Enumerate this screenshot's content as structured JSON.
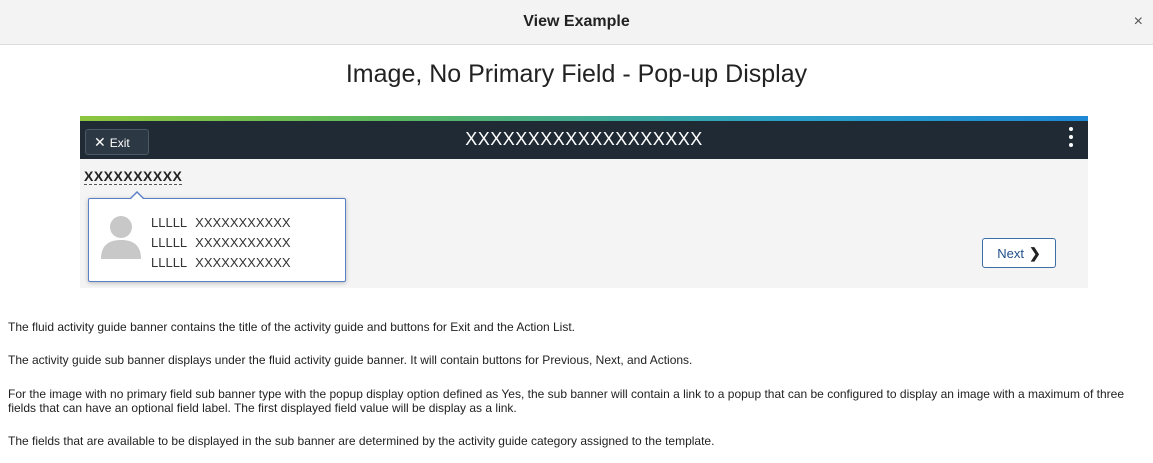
{
  "dialog": {
    "title": "View Example",
    "close": "×"
  },
  "heading": "Image, No Primary Field - Pop-up Display",
  "banner": {
    "exit_icon": "✕",
    "exit_label": "Exit",
    "title": "XXXXXXXXXXXXXXXXXXX",
    "menu_icon": "kebab-icon"
  },
  "sub_banner": {
    "link_text": "XXXXXXXXXX",
    "next_label": "Next",
    "next_chevron": "❯"
  },
  "popup": {
    "rows": [
      {
        "label": "LLLLL",
        "value": "XXXXXXXXXXX"
      },
      {
        "label": "LLLLL",
        "value": "XXXXXXXXXXX"
      },
      {
        "label": "LLLLL",
        "value": "XXXXXXXXXXX"
      }
    ]
  },
  "paragraphs": [
    "The fluid activity guide banner contains the title of the activity guide and buttons for Exit and the Action List.",
    "The activity guide sub banner displays under the fluid activity guide banner.  It will contain buttons for Previous, Next, and Actions.",
    "For the image with no primary field sub banner type with the popup display option defined as Yes, the sub banner will contain a link to a popup that can be configured to display an image with a maximum of three fields that can have an optional field label.  The first displayed field value will be display as a link.",
    "The fields that are available to be displayed in the sub banner are determined by the activity guide category assigned to the template."
  ]
}
